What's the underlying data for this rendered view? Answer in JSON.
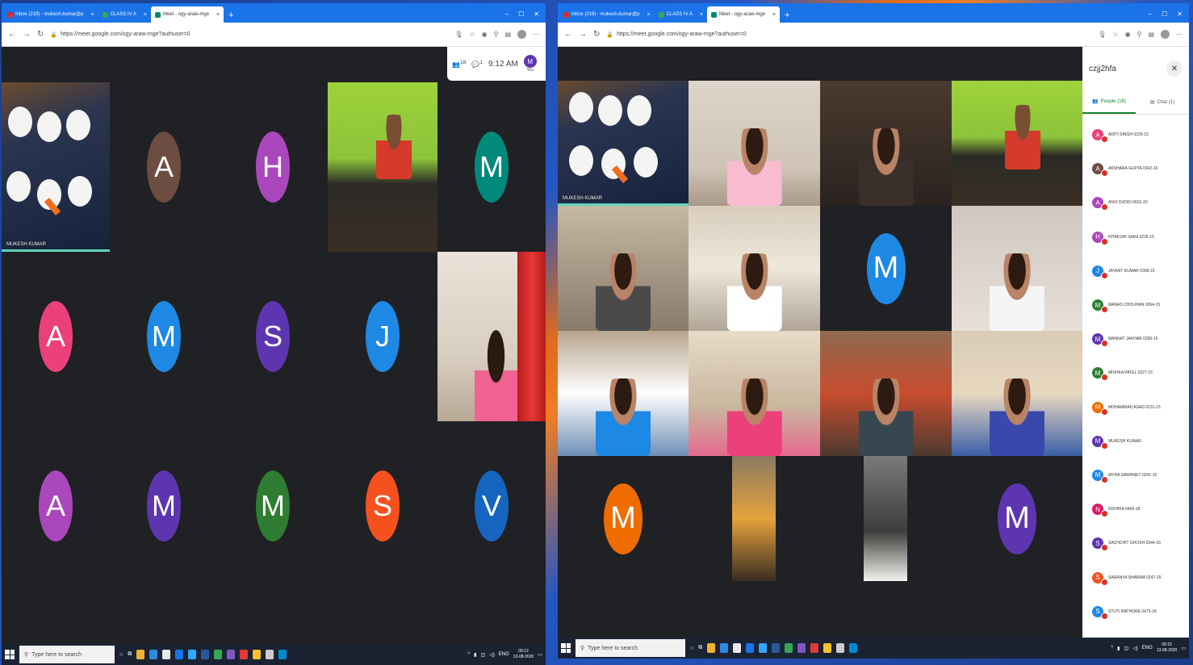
{
  "left": {
    "tabs": [
      {
        "label": "Inbox (219) - mukesh.kumar@p",
        "fav": "mail-icon"
      },
      {
        "label": "CLASS IV A",
        "fav": "classroom-icon"
      },
      {
        "label": "Meet - ogy-araw-mge",
        "fav": "meet-icon",
        "active": true
      }
    ],
    "url": "https://meet.google.com/ogy-araw-mge?authuser=0",
    "time": "9:12 AM",
    "you_label": "You",
    "you_initial": "M",
    "participant_count": "18",
    "chat_count": "1",
    "tiles": [
      {
        "type": "video",
        "label": "MUKESH KUMAR",
        "active": true
      },
      {
        "type": "avatar",
        "initial": "A",
        "color": "#6d4c41"
      },
      {
        "type": "avatar",
        "initial": "H",
        "color": "#ab47bc"
      },
      {
        "type": "video"
      },
      {
        "type": "avatar",
        "initial": "M",
        "color": "#00897b"
      },
      {
        "type": "avatar",
        "initial": "A",
        "color": "#ec407a"
      },
      {
        "type": "avatar",
        "initial": "M",
        "color": "#1e88e5"
      },
      {
        "type": "avatar",
        "initial": "S",
        "color": "#5e35b1"
      },
      {
        "type": "avatar",
        "initial": "J",
        "color": "#1e88e5"
      },
      {
        "type": "video"
      },
      {
        "type": "avatar",
        "initial": "A",
        "color": "#ab47bc"
      },
      {
        "type": "avatar",
        "initial": "M",
        "color": "#5e35b1"
      },
      {
        "type": "avatar",
        "initial": "M",
        "color": "#2e7d32"
      },
      {
        "type": "avatar",
        "initial": "S",
        "color": "#f4511e"
      },
      {
        "type": "avatar",
        "initial": "V",
        "color": "#1565c0"
      }
    ],
    "search_placeholder": "Type here to search",
    "clock_time": "09:12",
    "clock_date": "13-08-2020",
    "lang": "ENG"
  },
  "right": {
    "tabs": [
      {
        "label": "Inbox (219) - mukesh.kumar@p",
        "fav": "mail-icon"
      },
      {
        "label": "CLASS IV A",
        "fav": "classroom-icon"
      },
      {
        "label": "Meet - ogy-araw-mge",
        "fav": "meet-icon",
        "active": true
      }
    ],
    "url": "https://meet.google.com/ogy-araw-mge?authuser=0",
    "meeting_code": "czjj2hfa",
    "people_tab": "People (18)",
    "chat_tab": "Chat (1)",
    "tile_label": "MUKESH KUMAR",
    "avatar_tiles": [
      {
        "initial": "M",
        "color": "#1e88e5"
      },
      {
        "initial": "M",
        "color": "#ef6c00"
      },
      {
        "initial": "M",
        "color": "#5e35b1"
      }
    ],
    "participants": [
      {
        "initial": "A",
        "name": "ADITI SINGH 0229-15",
        "color": "#ec407a"
      },
      {
        "initial": "A",
        "name": "AKSHARA GUPTA 0342-16",
        "color": "#6d4c41"
      },
      {
        "initial": "A",
        "name": "ANVI DUDDI 0601-20",
        "color": "#ab47bc"
      },
      {
        "initial": "H",
        "name": "HITAKSHI SAINI 0226-15",
        "color": "#ab47bc"
      },
      {
        "initial": "J",
        "name": "JAYANT KUMAR 0308-15",
        "color": "#1e88e5"
      },
      {
        "initial": "M",
        "name": "MANAS CHOUHAN 0264-15",
        "color": "#2e7d32"
      },
      {
        "initial": "M",
        "name": "MANNAT JAKHAR 0280-15",
        "color": "#5e35b1"
      },
      {
        "initial": "M",
        "name": "MISHKA PATEL 0227-15",
        "color": "#2e7d32"
      },
      {
        "initial": "M",
        "name": "MOHAMMAD ASAD 0231-15",
        "color": "#ef6c00"
      },
      {
        "initial": "M",
        "name": "MUKESH KUMAR",
        "color": "#5e35b1"
      },
      {
        "initial": "M",
        "name": "MYRA SAWHNEY 0241-15",
        "color": "#1e88e5"
      },
      {
        "initial": "N",
        "name": "NISHIKA 0469-18",
        "color": "#d81b60"
      },
      {
        "initial": "S",
        "name": "SACHCHIT GHOSH 0344-16",
        "color": "#5e35b1"
      },
      {
        "initial": "S",
        "name": "SARANYA SHARMA 0247-15",
        "color": "#f4511e"
      },
      {
        "initial": "S",
        "name": "STUTI RATHORE 0473-18",
        "color": "#1e88e5"
      }
    ],
    "search_placeholder": "Type here to search",
    "clock_time": "09:15",
    "clock_date": "13-08-2020",
    "lang": "ENG"
  }
}
